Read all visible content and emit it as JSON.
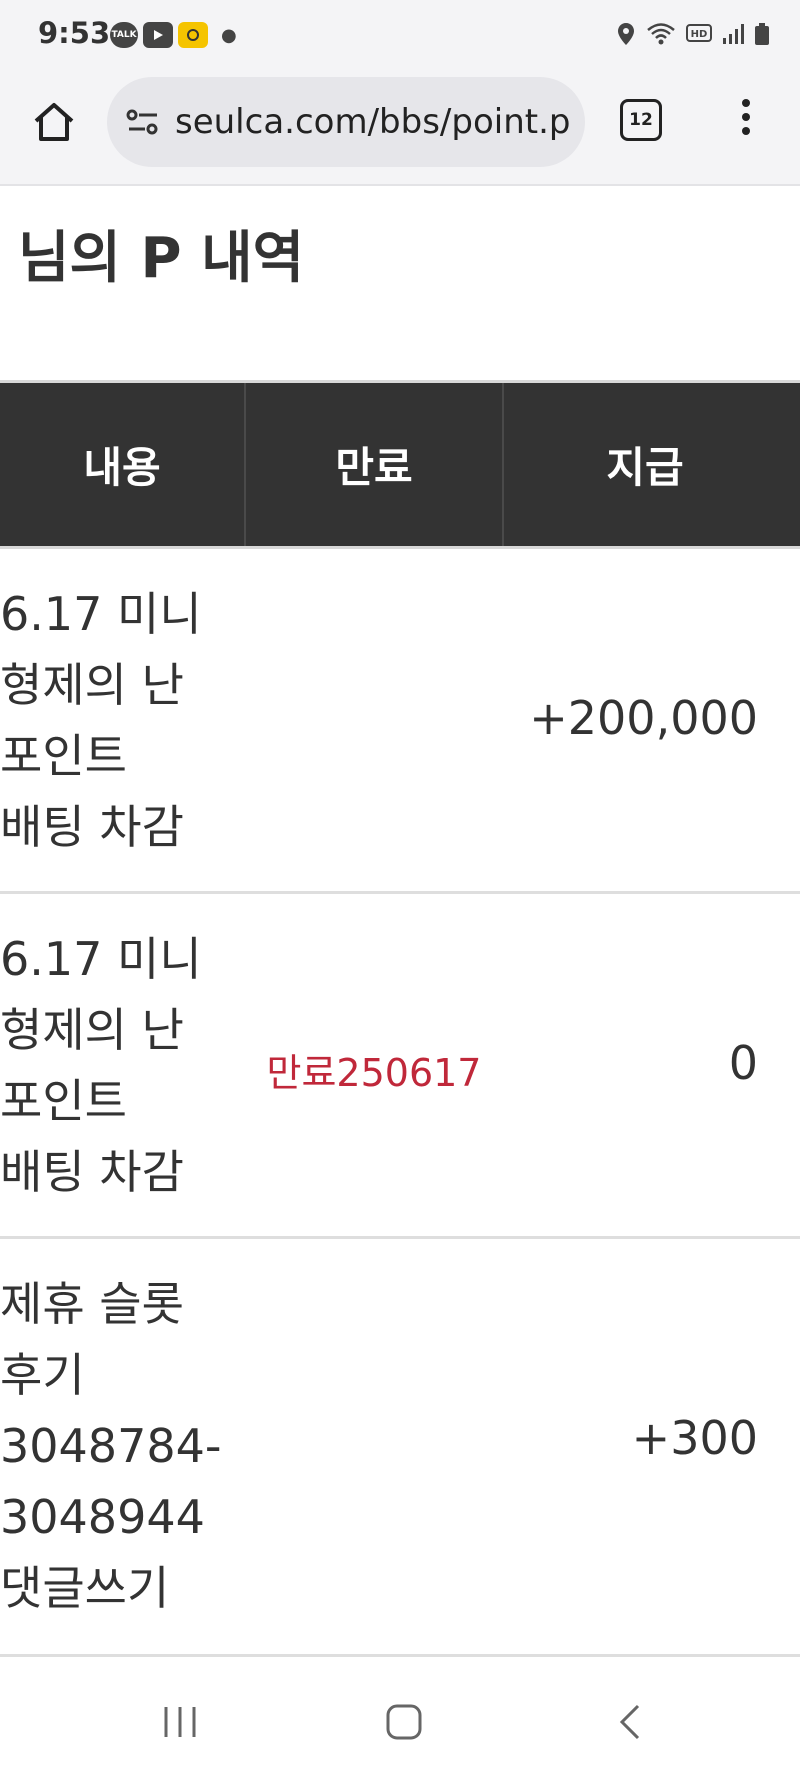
{
  "status_bar": {
    "time": "9:53",
    "notifications": [
      "talk-icon",
      "youtube-icon",
      "app-icon"
    ],
    "indicators": [
      "location-icon",
      "wifi-icon",
      "hd-icon",
      "signal-icon",
      "battery-icon"
    ]
  },
  "browser": {
    "url": "seulca.com/bbs/point.p",
    "tab_count": "12"
  },
  "page": {
    "title": "님의 P 내역"
  },
  "table": {
    "headers": [
      "내용",
      "만료",
      "지급"
    ],
    "rows": [
      {
        "desc": "6.17 미니 형제의 난 포인트 배팅 차감",
        "expiry": "",
        "amount": "+200,000"
      },
      {
        "desc": "6.17 미니 형제의 난 포인트 배팅 차감",
        "expiry": "만료250617",
        "amount": "0"
      },
      {
        "desc": "제휴 슬롯 후기 3048784-3048944 댓글쓰기",
        "expiry": "",
        "amount": "+300"
      }
    ]
  },
  "colors": {
    "header_bg": "#333333",
    "expiry_red": "#c0283a",
    "chrome_bg": "#f4f4f6"
  }
}
